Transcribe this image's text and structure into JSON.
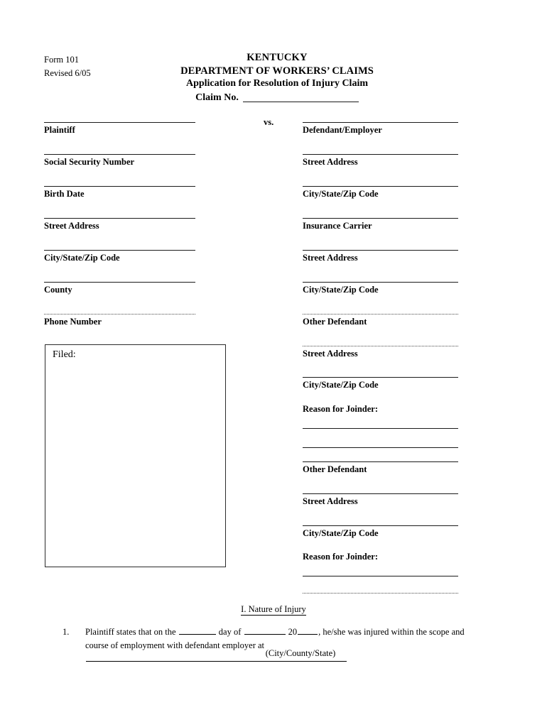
{
  "header": {
    "form_number": "Form 101",
    "revised": "Revised 6/05",
    "title_line_1": "KENTUCKY",
    "title_line_2": "DEPARTMENT OF WORKERS’ CLAIMS",
    "title_line_3": "Application for Resolution of Injury Claim",
    "claim_no_label": "Claim No.",
    "claim_no_value": ""
  },
  "parties": {
    "vs_label": "vs.",
    "plaintiff_fields": [
      {
        "label": "Plaintiff",
        "value": ""
      },
      {
        "label": "Social Security Number",
        "value": ""
      },
      {
        "label": "Birth Date",
        "value": ""
      },
      {
        "label": "Street Address",
        "value": ""
      },
      {
        "label": "City/State/Zip Code",
        "value": ""
      },
      {
        "label": "County",
        "value": ""
      },
      {
        "label": "Phone Number",
        "value": ""
      }
    ],
    "defendant_fields": [
      {
        "label": "Defendant/Employer",
        "value": ""
      },
      {
        "label": "Street Address",
        "value": ""
      },
      {
        "label": "City/State/Zip Code",
        "value": ""
      },
      {
        "label": "Insurance Carrier",
        "value": ""
      },
      {
        "label": "Street Address",
        "value": ""
      },
      {
        "label": "City/State/Zip Code",
        "value": ""
      },
      {
        "label": "Other Defendant",
        "value": ""
      },
      {
        "label": "Street Address",
        "value": ""
      },
      {
        "label": "City/State/Zip Code",
        "value": ""
      }
    ],
    "joinder_1": {
      "label": "Reason for Joinder:",
      "line_1": "",
      "line_2": ""
    },
    "other_defendant_2": [
      {
        "label": "Other Defendant",
        "value": ""
      },
      {
        "label": "Street Address",
        "value": ""
      },
      {
        "label": "City/State/Zip Code",
        "value": ""
      }
    ],
    "joinder_2": {
      "label": "Reason for Joinder:",
      "line_1": "",
      "line_2": ""
    }
  },
  "filed_box": {
    "label": "Filed:",
    "value": ""
  },
  "section_one": {
    "heading": "I.  Nature of Injury",
    "item_number": "1.",
    "text_part_1": "Plaintiff states that on the",
    "text_part_2": "day of",
    "text_part_3": "20",
    "text_part_4": ", he/she was injured within the scope and course of",
    "text_part_5": "employment with defendant employer at",
    "caption": "(City/County/State)",
    "day_value": "",
    "month_value": "",
    "year_value": "",
    "place_value": ""
  }
}
